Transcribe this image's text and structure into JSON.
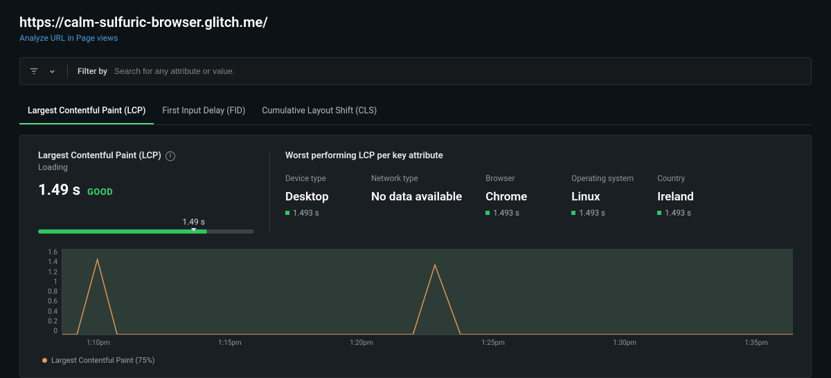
{
  "header": {
    "url": "https://calm-sulfuric-browser.glitch.me/",
    "sublink": "Analyze URL in Page views"
  },
  "filter": {
    "label": "Filter by",
    "placeholder": "Search for any attribute or value."
  },
  "tabs": [
    {
      "label": "Largest Contentful Paint (LCP)",
      "active": true
    },
    {
      "label": "First Input Delay (FID)",
      "active": false
    },
    {
      "label": "Cumulative Layout Shift (CLS)",
      "active": false
    }
  ],
  "metric": {
    "title": "Largest Contentful Paint (LCP)",
    "subtitle": "Loading",
    "value": "1.49 s",
    "badge": "GOOD",
    "marker_label": "1.49 s"
  },
  "worst": {
    "heading": "Worst performing LCP per key attribute",
    "columns": [
      {
        "label": "Device type",
        "value": "Desktop",
        "sub": "1.493 s",
        "hasDot": true
      },
      {
        "label": "Network type",
        "value": "No data available",
        "sub": "",
        "hasDot": false
      },
      {
        "label": "Browser",
        "value": "Chrome",
        "sub": "1.493 s",
        "hasDot": true
      },
      {
        "label": "Operating system",
        "value": "Linux",
        "sub": "1.493 s",
        "hasDot": true
      },
      {
        "label": "Country",
        "value": "Ireland",
        "sub": "1.493 s",
        "hasDot": true
      }
    ]
  },
  "legend": {
    "label": "Largest Contentful Paint (75%)"
  },
  "chart_data": {
    "type": "line",
    "title": "",
    "xlabel": "",
    "ylabel": "",
    "ylim": [
      0,
      1.6
    ],
    "yticks": [
      1.6,
      1.4,
      1.2,
      1,
      0.8,
      0.6,
      0.4,
      0.2,
      0
    ],
    "xticks": [
      "1:10pm",
      "1:15pm",
      "1:20pm",
      "1:25pm",
      "1:30pm",
      "1:35pm"
    ],
    "series": [
      {
        "name": "Largest Contentful Paint (75%)",
        "color": "#e69b5c",
        "x_rel": [
          0.0,
          0.02,
          0.048,
          0.075,
          0.48,
          0.51,
          0.545,
          0.58,
          1.0
        ],
        "values": [
          0,
          0,
          1.4,
          0,
          0,
          1.3,
          0,
          0,
          0
        ]
      }
    ]
  }
}
